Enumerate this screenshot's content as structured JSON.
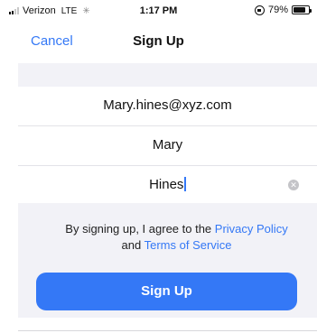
{
  "status_bar": {
    "carrier": "Verizon",
    "network": "LTE",
    "time": "1:17 PM",
    "battery_text": "79%",
    "battery_level": 0.79
  },
  "nav": {
    "cancel_label": "Cancel",
    "title": "Sign Up"
  },
  "form": {
    "email_value": "Mary.hines@xyz.com",
    "first_name_value": "Mary",
    "last_name_value": "Hines"
  },
  "legal": {
    "prefix": "By signing up, I agree to the ",
    "privacy_link": "Privacy Policy",
    "and": " and ",
    "terms_link": "Terms of Service"
  },
  "actions": {
    "signup_label": "Sign Up"
  },
  "colors": {
    "accent": "#3478f6",
    "background_gray": "#f2f2f7"
  },
  "icons": [
    "signal-icon",
    "loading-icon",
    "orientation-lock-icon",
    "battery-icon",
    "clear-icon"
  ]
}
